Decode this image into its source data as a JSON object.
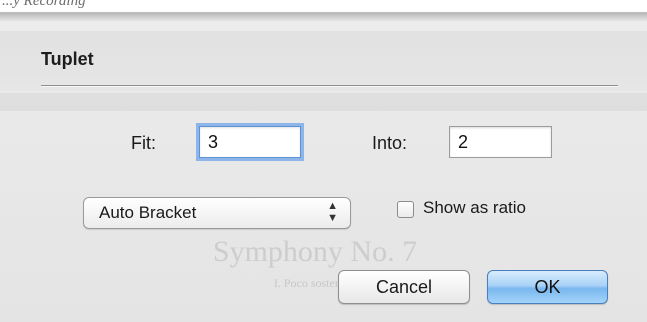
{
  "background_doc_text": "...y Recording",
  "dialog": {
    "title": "Tuplet",
    "fit_label": "Fit:",
    "fit_value": "3",
    "into_label": "Into:",
    "into_value": "2",
    "bracket_select": {
      "selected": "Auto Bracket",
      "icon": "up-down-arrows-icon"
    },
    "show_ratio_label": "Show as ratio",
    "show_ratio_checked": false,
    "cancel_label": "Cancel",
    "ok_label": "OK"
  },
  "ghost": {
    "score_title": "Symphony No. 7",
    "score_subtitle": "I. Poco sostenuto"
  },
  "colors": {
    "focus_ring": "#8cb6ea",
    "default_button": "#79b7ee",
    "dialog_bg": "#e8e8e8"
  }
}
